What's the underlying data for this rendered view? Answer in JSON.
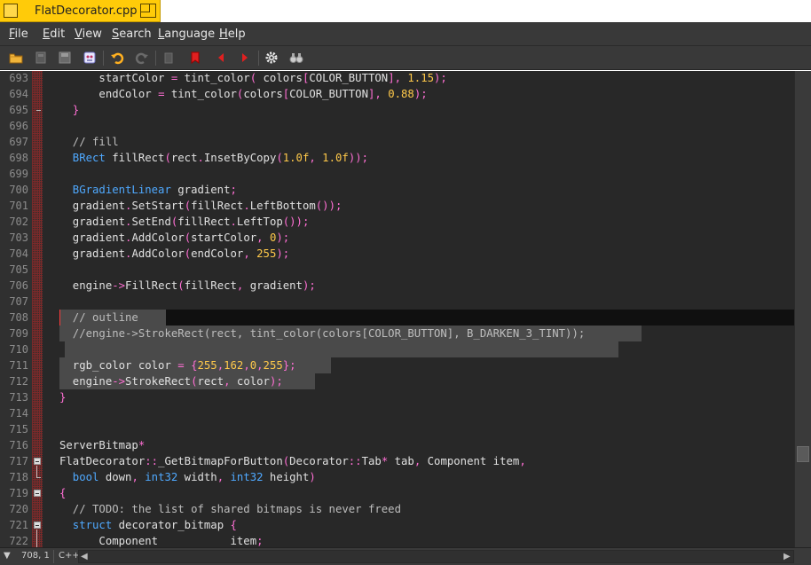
{
  "window": {
    "title": "FlatDecorator.cpp"
  },
  "menu": [
    {
      "pre": "",
      "u": "F",
      "post": "ile"
    },
    {
      "pre": "",
      "u": "E",
      "post": "dit"
    },
    {
      "pre": "",
      "u": "V",
      "post": "iew"
    },
    {
      "pre": "",
      "u": "S",
      "post": "earch"
    },
    {
      "pre": "",
      "u": "L",
      "post": "anguage"
    },
    {
      "pre": "",
      "u": "H",
      "post": "elp"
    }
  ],
  "toolbar": {
    "icons": [
      "open-folder-icon",
      "disk-stack-icon",
      "save-icon",
      "print-icon",
      "undo-icon",
      "redo-icon",
      "paste-icon",
      "bookmark-icon",
      "prev-bookmark-icon",
      "next-bookmark-icon",
      "settings-gear-icon",
      "binoculars-icon"
    ]
  },
  "editor": {
    "lines": [
      {
        "n": "693",
        "tokens": [
          [
            "",
            "      startColor "
          ],
          [
            "op",
            "="
          ],
          [
            "",
            " tint_color"
          ],
          [
            "op",
            "("
          ],
          [
            "",
            " colors"
          ],
          [
            "op",
            "["
          ],
          [
            "",
            "COLOR_BUTTON"
          ],
          [
            "op",
            "],"
          ],
          [
            "num",
            " 1.15"
          ],
          [
            "op",
            ");"
          ]
        ]
      },
      {
        "n": "694",
        "tokens": [
          [
            "",
            "      endColor "
          ],
          [
            "op",
            "="
          ],
          [
            "",
            " tint_color"
          ],
          [
            "op",
            "("
          ],
          [
            "",
            "colors"
          ],
          [
            "op",
            "["
          ],
          [
            "",
            "COLOR_BUTTON"
          ],
          [
            "op",
            "],"
          ],
          [
            "num",
            " 0.88"
          ],
          [
            "op",
            ");"
          ]
        ]
      },
      {
        "n": "695",
        "tokens": [
          [
            "op",
            "  }"
          ]
        ]
      },
      {
        "n": "696",
        "tokens": []
      },
      {
        "n": "697",
        "tokens": [
          [
            "com",
            "  // fill"
          ]
        ]
      },
      {
        "n": "698",
        "tokens": [
          [
            "type",
            "  BRect"
          ],
          [
            "",
            " fillRect"
          ],
          [
            "op",
            "("
          ],
          [
            "",
            "rect"
          ],
          [
            "op",
            "."
          ],
          [
            "",
            "InsetByCopy"
          ],
          [
            "op",
            "("
          ],
          [
            "num",
            "1.0f"
          ],
          [
            "op",
            ","
          ],
          [
            "num",
            " 1.0f"
          ],
          [
            "op",
            "));"
          ]
        ]
      },
      {
        "n": "699",
        "tokens": []
      },
      {
        "n": "700",
        "tokens": [
          [
            "type",
            "  BGradientLinear"
          ],
          [
            "",
            " gradient"
          ],
          [
            "op",
            ";"
          ]
        ]
      },
      {
        "n": "701",
        "tokens": [
          [
            "",
            "  gradient"
          ],
          [
            "op",
            "."
          ],
          [
            "",
            "SetStart"
          ],
          [
            "op",
            "("
          ],
          [
            "",
            "fillRect"
          ],
          [
            "op",
            "."
          ],
          [
            "",
            "LeftBottom"
          ],
          [
            "op",
            "());"
          ]
        ]
      },
      {
        "n": "702",
        "tokens": [
          [
            "",
            "  gradient"
          ],
          [
            "op",
            "."
          ],
          [
            "",
            "SetEnd"
          ],
          [
            "op",
            "("
          ],
          [
            "",
            "fillRect"
          ],
          [
            "op",
            "."
          ],
          [
            "",
            "LeftTop"
          ],
          [
            "op",
            "());"
          ]
        ]
      },
      {
        "n": "703",
        "tokens": [
          [
            "",
            "  gradient"
          ],
          [
            "op",
            "."
          ],
          [
            "",
            "AddColor"
          ],
          [
            "op",
            "("
          ],
          [
            "",
            "startColor"
          ],
          [
            "op",
            ","
          ],
          [
            "num",
            " 0"
          ],
          [
            "op",
            ");"
          ]
        ]
      },
      {
        "n": "704",
        "tokens": [
          [
            "",
            "  gradient"
          ],
          [
            "op",
            "."
          ],
          [
            "",
            "AddColor"
          ],
          [
            "op",
            "("
          ],
          [
            "",
            "endColor"
          ],
          [
            "op",
            ","
          ],
          [
            "num",
            " 255"
          ],
          [
            "op",
            ");"
          ]
        ]
      },
      {
        "n": "705",
        "tokens": []
      },
      {
        "n": "706",
        "tokens": [
          [
            "",
            "  engine"
          ],
          [
            "op",
            "->"
          ],
          [
            "",
            "FillRect"
          ],
          [
            "op",
            "("
          ],
          [
            "",
            "fillRect"
          ],
          [
            "op",
            ","
          ],
          [
            "",
            " gradient"
          ],
          [
            "op",
            ");"
          ]
        ]
      },
      {
        "n": "707",
        "tokens": []
      },
      {
        "n": "708",
        "tokens": [
          [
            "com",
            "  // outline"
          ]
        ]
      },
      {
        "n": "709",
        "tokens": [
          [
            "com",
            "  //engine->StrokeRect(rect, tint_color(colors[COLOR_BUTTON], B_DARKEN_3_TINT));"
          ]
        ]
      },
      {
        "n": "710",
        "tokens": []
      },
      {
        "n": "711",
        "tokens": [
          [
            "",
            "  rgb_color color "
          ],
          [
            "op",
            "="
          ],
          [
            "op",
            " {"
          ],
          [
            "num",
            "255"
          ],
          [
            "op",
            ","
          ],
          [
            "num",
            "162"
          ],
          [
            "op",
            ","
          ],
          [
            "num",
            "0"
          ],
          [
            "op",
            ","
          ],
          [
            "num",
            "255"
          ],
          [
            "op",
            "};"
          ]
        ]
      },
      {
        "n": "712",
        "tokens": [
          [
            "",
            "  engine"
          ],
          [
            "op",
            "->"
          ],
          [
            "",
            "StrokeRect"
          ],
          [
            "op",
            "("
          ],
          [
            "",
            "rect"
          ],
          [
            "op",
            ","
          ],
          [
            "",
            " color"
          ],
          [
            "op",
            ");"
          ]
        ]
      },
      {
        "n": "713",
        "tokens": [
          [
            "op",
            "}"
          ]
        ]
      },
      {
        "n": "714",
        "tokens": []
      },
      {
        "n": "715",
        "tokens": []
      },
      {
        "n": "716",
        "tokens": [
          [
            "",
            "ServerBitmap"
          ],
          [
            "op",
            "*"
          ]
        ]
      },
      {
        "n": "717",
        "tokens": [
          [
            "",
            "FlatDecorator"
          ],
          [
            "op",
            "::"
          ],
          [
            "",
            "_GetBitmapForButton"
          ],
          [
            "op",
            "("
          ],
          [
            "",
            "Decorator"
          ],
          [
            "op",
            "::"
          ],
          [
            "",
            "Tab"
          ],
          [
            "op",
            "*"
          ],
          [
            "",
            " tab"
          ],
          [
            "op",
            ","
          ],
          [
            "",
            " Component item"
          ],
          [
            "op",
            ","
          ]
        ]
      },
      {
        "n": "718",
        "tokens": [
          [
            "type",
            "  bool"
          ],
          [
            "",
            " down"
          ],
          [
            "op",
            ","
          ],
          [
            "type",
            " int32"
          ],
          [
            "",
            " width"
          ],
          [
            "op",
            ","
          ],
          [
            "type",
            " int32"
          ],
          [
            "",
            " height"
          ],
          [
            "op",
            ")"
          ]
        ]
      },
      {
        "n": "719",
        "tokens": [
          [
            "op",
            "{"
          ]
        ]
      },
      {
        "n": "720",
        "tokens": [
          [
            "com",
            "  // TODO: the list of shared bitmaps is never freed"
          ]
        ]
      },
      {
        "n": "721",
        "tokens": [
          [
            "type",
            "  struct"
          ],
          [
            "",
            " decorator_bitmap "
          ],
          [
            "op",
            "{"
          ]
        ]
      },
      {
        "n": "722",
        "tokens": [
          [
            "",
            "      Component           item"
          ],
          [
            "op",
            ";"
          ]
        ]
      }
    ]
  },
  "status": {
    "position": "708, 1",
    "language": "C++"
  },
  "colors": {
    "titleTab": "#ffcb09",
    "chrome": "#393939",
    "editorBg": "#282828",
    "type": "#4fa9ff",
    "number": "#ffc94a",
    "operator": "#ff6fd4"
  }
}
